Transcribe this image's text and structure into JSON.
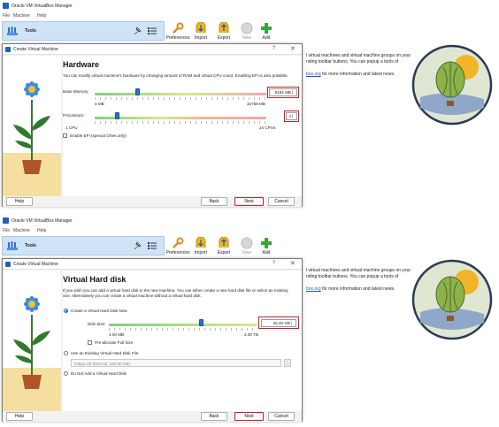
{
  "panels": [
    {
      "main_window": {
        "title": "Oracle VM VirtualBox Manager",
        "menu": [
          "File",
          "Machine",
          "Help"
        ],
        "tools_label": "Tools",
        "toolbar": [
          "Preferences",
          "Import",
          "Export",
          "New",
          "Add"
        ],
        "welcome_text": "l virtual machines and virtual machine groups on your nding toolbar buttons. You can popup a tools of",
        "welcome_link": "box.org",
        "welcome_tail": "for more information and latest news."
      },
      "dialog": {
        "title": "Create Virtual Machine",
        "help_glyph": "?",
        "close_glyph": "✕",
        "step_title": "Hardware",
        "description": "You can modify virtual machine's hardware by changing amount of RAM and virtual CPU count. Enabling EFI is also possible.",
        "memory_label": "Base Memory:",
        "memory_value": "8192 MB",
        "memory_min": "4 MB",
        "memory_max": "32768 MB",
        "memory_fraction": 0.25,
        "cpu_label": "Processors:",
        "cpu_value": "4",
        "cpu_min": "1 CPU",
        "cpu_max": "24 CPUs",
        "cpu_fraction": 0.13,
        "efi_label": "Enable EFI (special OSes only)",
        "buttons": {
          "help": "Help",
          "back": "Back",
          "next": "Next",
          "cancel": "Cancel"
        }
      }
    },
    {
      "main_window": {
        "title": "Oracle VM VirtualBox Manager",
        "menu": [
          "File",
          "Machine",
          "Help"
        ],
        "tools_label": "Tools",
        "toolbar": [
          "Preferences",
          "Import",
          "Export",
          "New",
          "Add"
        ],
        "welcome_text": "l virtual machines and virtual machine groups on your nding toolbar buttons. You can popup a tools of",
        "welcome_link": "box.org",
        "welcome_tail": "for more information and latest news."
      },
      "dialog": {
        "title": "Create Virtual Machine",
        "help_glyph": "?",
        "close_glyph": "✕",
        "step_title": "Virtual Hard disk",
        "description": "If you wish you can add a virtual hard disk to the new machine. You can either create a new hard disk file or select an existing one. Alternatively you can create a virtual machine without a virtual hard disk.",
        "opt_create": "Create a Virtual Hard Disk Now",
        "disk_size_label": "Disk Size:",
        "disk_size_value": "25.00 GB",
        "disk_min": "4.00 MB",
        "disk_max": "2.00 TB",
        "disk_fraction": 0.62,
        "prealloc_label": "Pre-allocate Full Size",
        "opt_existing": "Use an Existing Virtual Hard Disk File",
        "existing_value": "indigo.vdi (Normal, 150.00 GB)",
        "opt_none": "Do Not Add a Virtual Hard Disk",
        "buttons": {
          "help": "Help",
          "back": "Back",
          "next": "Next",
          "cancel": "Cancel"
        }
      }
    }
  ],
  "colors": {
    "highlight": "#d01b25",
    "accent": "#1d5fbf",
    "tools_bar": "#cfe3f7"
  },
  "icons": [
    "virtualbox-logo-icon",
    "tools-icon",
    "pin-icon",
    "list-icon",
    "preferences-icon",
    "import-icon",
    "export-icon",
    "new-icon",
    "add-icon",
    "help-icon",
    "close-icon",
    "sunflower-illustration",
    "balloon-illustration"
  ]
}
